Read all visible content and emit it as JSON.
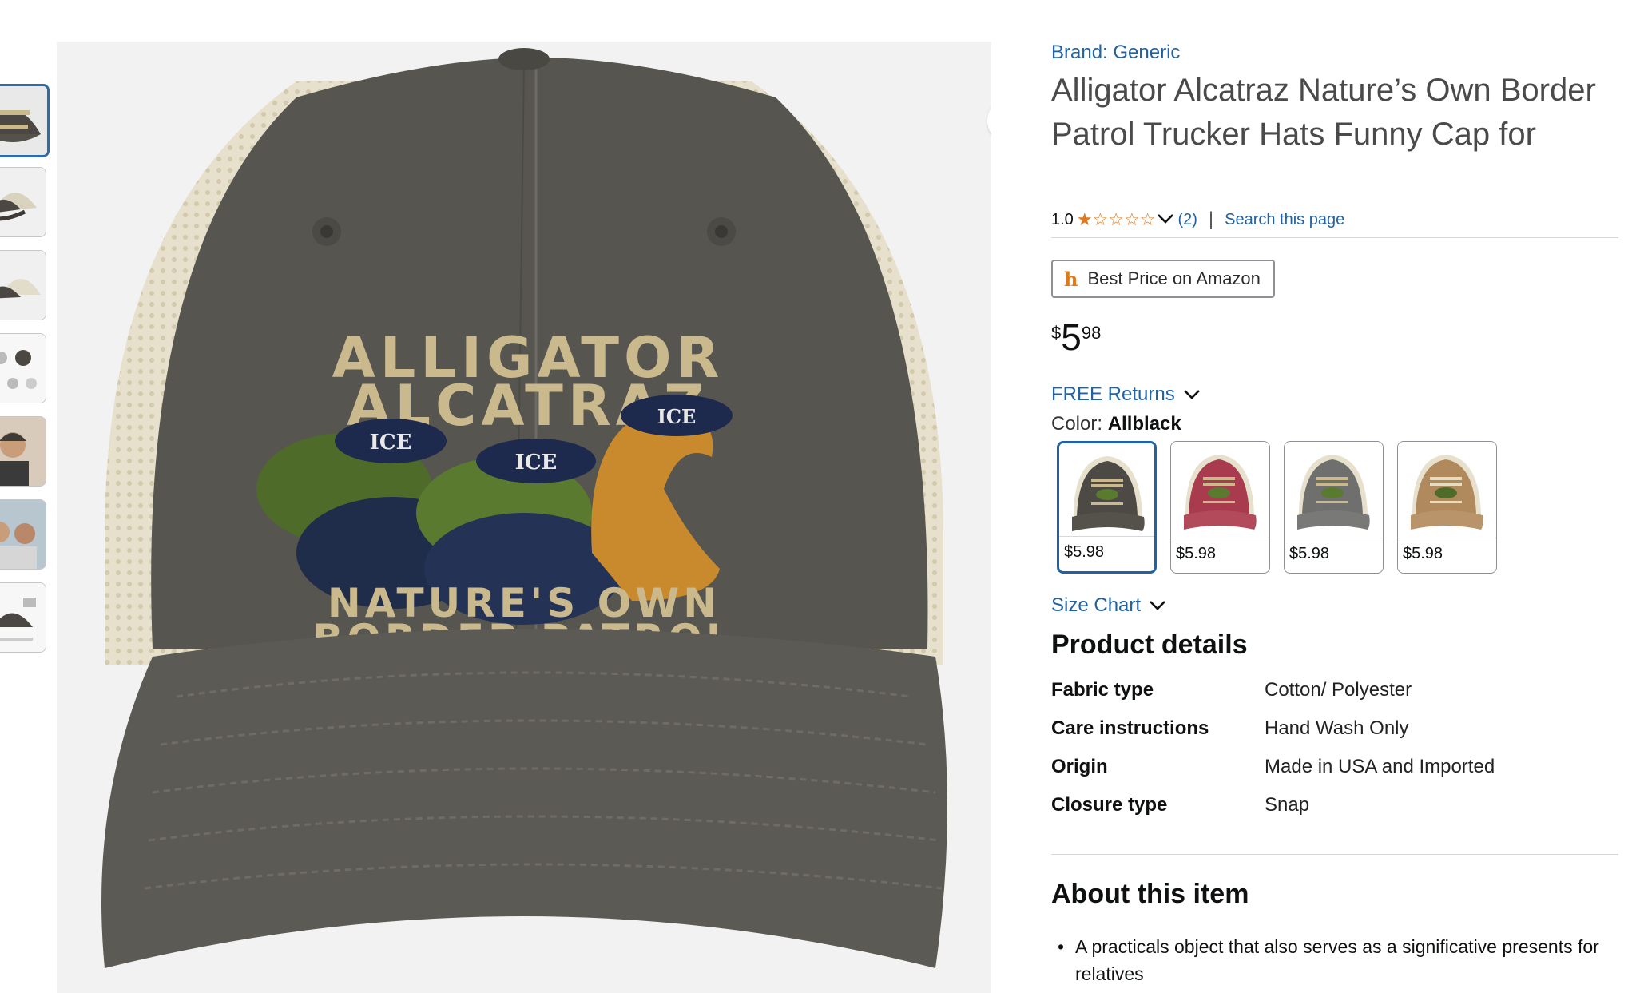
{
  "product": {
    "brand": "Brand: Generic",
    "title": "Alligator Alcatraz Nature’s Own Border Patrol Trucker Hats Funny Cap for",
    "rating_value": "1.0",
    "rating_stars": "★☆☆☆☆",
    "rating_count": "(2)",
    "search_page": "Search this page",
    "best_price_label": "Best Price on Amazon",
    "price": {
      "currency": "$",
      "whole": "5",
      "fraction": "98"
    },
    "free_returns": "FREE Returns",
    "color_label": "Color:",
    "color_value": "Allblack",
    "swatches": [
      {
        "price": "$5.98",
        "color": "#4d4a45"
      },
      {
        "price": "$5.98",
        "color": "#a83c4e"
      },
      {
        "price": "$5.98",
        "color": "#6f6f6d"
      },
      {
        "price": "$5.98",
        "color": "#b08a5d"
      }
    ],
    "size_chart": "Size Chart"
  },
  "details": {
    "heading": "Product details",
    "rows": [
      {
        "key": "Fabric type",
        "value": "Cotton/ Polyester"
      },
      {
        "key": "Care instructions",
        "value": "Hand Wash Only"
      },
      {
        "key": "Origin",
        "value": "Made in USA and Imported"
      },
      {
        "key": "Closure type",
        "value": "Snap"
      }
    ]
  },
  "about": {
    "heading": "About this item",
    "bullets": [
      "A practicals object that also serves as a significative presents for relatives"
    ]
  },
  "hat_print": {
    "line1": "ALLIGATOR",
    "line2": "ALCATRAZ",
    "line3": "NATURE'S OWN",
    "line4": "BORDER PATROL",
    "cap_text": "ICE"
  },
  "icons": {
    "share": "share-icon",
    "chevron": "chevron-down-icon",
    "best_price": "h-logo-icon"
  },
  "colors": {
    "link": "#2162a1",
    "star": "#de7921",
    "selected_border": "#2162a1",
    "hat_text": "#c9b98d"
  }
}
